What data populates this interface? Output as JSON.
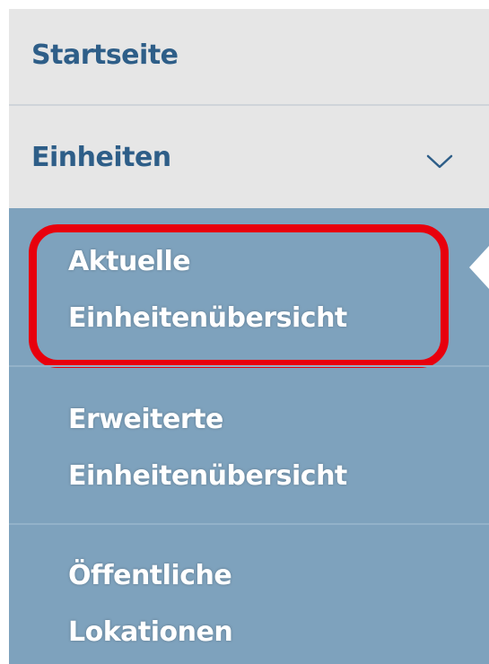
{
  "menu": {
    "start_label": "Startseite",
    "units_label": "Einheiten",
    "units_expanded": true,
    "chevron_icon": "chevron-down-icon",
    "submenu": [
      {
        "line1": "Aktuelle",
        "line2": "Einheitenübersicht",
        "active": true,
        "highlighted": true
      },
      {
        "line1": "Erweiterte",
        "line2": "Einheitenübersicht",
        "active": false
      },
      {
        "line1": "Öffentliche",
        "line2": "Lokationen",
        "active": false
      }
    ]
  },
  "colors": {
    "top_bg": "#e6e6e6",
    "top_text": "#2e5e88",
    "submenu_bg": "#7ea2bd",
    "submenu_text": "#ffffff",
    "highlight": "#e8000d"
  }
}
